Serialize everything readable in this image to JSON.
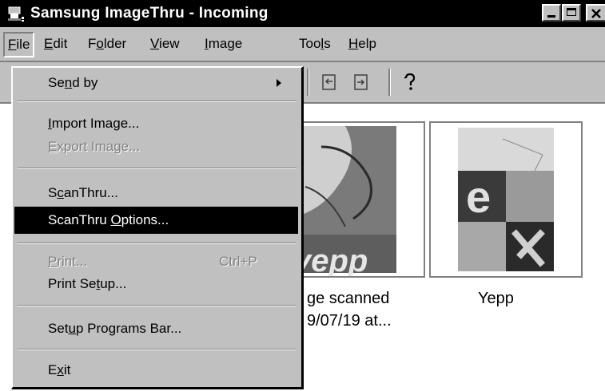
{
  "window": {
    "title": "Samsung ImageThru - Incoming"
  },
  "menubar": {
    "items": [
      {
        "pre": "",
        "key": "F",
        "post": "ile"
      },
      {
        "pre": "",
        "key": "E",
        "post": "dit"
      },
      {
        "pre": "F",
        "key": "o",
        "post": "lder"
      },
      {
        "pre": "",
        "key": "V",
        "post": "iew"
      },
      {
        "pre": "",
        "key": "I",
        "post": "mage"
      },
      {
        "pre": "Too",
        "key": "l",
        "post": "s"
      },
      {
        "pre": "",
        "key": "H",
        "post": "elp"
      }
    ]
  },
  "file_menu": {
    "send_by": {
      "pre": "Se",
      "key": "n",
      "post": "d by"
    },
    "import_image": {
      "pre": "",
      "key": "I",
      "post": "mport Image..."
    },
    "export_image": {
      "pre": "",
      "key": "E",
      "post": "xport Image..."
    },
    "scanthru": {
      "pre": "S",
      "key": "c",
      "post": "anThru..."
    },
    "scanthru_options": {
      "pre": "ScanThru ",
      "key": "O",
      "post": "ptions..."
    },
    "print": {
      "pre": "",
      "key": "P",
      "post": "rint...",
      "shortcut": "Ctrl+P"
    },
    "print_setup": {
      "pre": "Print Se",
      "key": "t",
      "post": "up..."
    },
    "setup_programs_bar": {
      "pre": "Set",
      "key": "u",
      "post": "p Programs Bar..."
    },
    "exit": {
      "pre": "E",
      "key": "x",
      "post": "it"
    }
  },
  "content": {
    "items": [
      {
        "caption_line1": "ge scanned",
        "caption_line2": "9/07/19 at..."
      },
      {
        "caption_line1": "Yepp"
      }
    ]
  },
  "thumbnails": {
    "image1_text": "yepp",
    "image2_text": "e"
  }
}
